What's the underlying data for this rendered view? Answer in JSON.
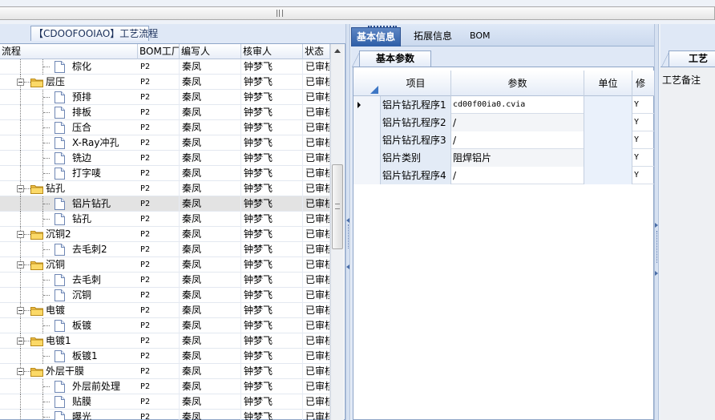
{
  "left_tab": "【CDOOFOOIAO】工艺流程",
  "tree_grid": {
    "headers": [
      "流程",
      "BOM工厂",
      "编写人",
      "核审人",
      "状态"
    ],
    "rows": [
      {
        "name": "棕化",
        "level": 2,
        "type": "doc",
        "bom": "P2",
        "writer": "秦凤",
        "reviewer": "钟梦飞",
        "status": "已审核"
      },
      {
        "name": "层压",
        "level": 1,
        "type": "folder",
        "bom": "P2",
        "writer": "秦凤",
        "reviewer": "钟梦飞",
        "status": "已审核"
      },
      {
        "name": "预排",
        "level": 2,
        "type": "doc",
        "bom": "P2",
        "writer": "秦凤",
        "reviewer": "钟梦飞",
        "status": "已审核"
      },
      {
        "name": "排板",
        "level": 2,
        "type": "doc",
        "bom": "P2",
        "writer": "秦凤",
        "reviewer": "钟梦飞",
        "status": "已审核"
      },
      {
        "name": "压合",
        "level": 2,
        "type": "doc",
        "bom": "P2",
        "writer": "秦凤",
        "reviewer": "钟梦飞",
        "status": "已审核"
      },
      {
        "name": "X-Ray冲孔",
        "level": 2,
        "type": "doc",
        "bom": "P2",
        "writer": "秦凤",
        "reviewer": "钟梦飞",
        "status": "已审核"
      },
      {
        "name": "铣边",
        "level": 2,
        "type": "doc",
        "bom": "P2",
        "writer": "秦凤",
        "reviewer": "钟梦飞",
        "status": "已审核"
      },
      {
        "name": "打字唛",
        "level": 2,
        "type": "doc",
        "bom": "P2",
        "writer": "秦凤",
        "reviewer": "钟梦飞",
        "status": "已审核"
      },
      {
        "name": "钻孔",
        "level": 1,
        "type": "folder",
        "bom": "P2",
        "writer": "秦凤",
        "reviewer": "钟梦飞",
        "status": "已审核"
      },
      {
        "name": "铝片钻孔",
        "level": 2,
        "type": "doc",
        "selected": true,
        "bom": "P2",
        "writer": "秦凤",
        "reviewer": "钟梦飞",
        "status": "已审核"
      },
      {
        "name": "钻孔",
        "level": 2,
        "type": "doc",
        "bom": "P2",
        "writer": "秦凤",
        "reviewer": "钟梦飞",
        "status": "已审核"
      },
      {
        "name": "沉铜2",
        "level": 1,
        "type": "folder",
        "bom": "P2",
        "writer": "秦凤",
        "reviewer": "钟梦飞",
        "status": "已审核"
      },
      {
        "name": "去毛刺2",
        "level": 2,
        "type": "doc",
        "bom": "P2",
        "writer": "秦凤",
        "reviewer": "钟梦飞",
        "status": "已审核"
      },
      {
        "name": "沉铜",
        "level": 1,
        "type": "folder",
        "bom": "P2",
        "writer": "秦凤",
        "reviewer": "钟梦飞",
        "status": "已审核"
      },
      {
        "name": "去毛刺",
        "level": 2,
        "type": "doc",
        "bom": "P2",
        "writer": "秦凤",
        "reviewer": "钟梦飞",
        "status": "已审核"
      },
      {
        "name": "沉铜",
        "level": 2,
        "type": "doc",
        "bom": "P2",
        "writer": "秦凤",
        "reviewer": "钟梦飞",
        "status": "已审核"
      },
      {
        "name": "电镀",
        "level": 1,
        "type": "folder",
        "bom": "P2",
        "writer": "秦凤",
        "reviewer": "钟梦飞",
        "status": "已审核"
      },
      {
        "name": "板镀",
        "level": 2,
        "type": "doc",
        "bom": "P2",
        "writer": "秦凤",
        "reviewer": "钟梦飞",
        "status": "已审核"
      },
      {
        "name": "电镀1",
        "level": 1,
        "type": "folder",
        "bom": "P2",
        "writer": "秦凤",
        "reviewer": "钟梦飞",
        "status": "已审核"
      },
      {
        "name": "板镀1",
        "level": 2,
        "type": "doc",
        "bom": "P2",
        "writer": "秦凤",
        "reviewer": "钟梦飞",
        "status": "已审核"
      },
      {
        "name": "外层干膜",
        "level": 1,
        "type": "folder",
        "bom": "P2",
        "writer": "秦凤",
        "reviewer": "钟梦飞",
        "status": "已审核"
      },
      {
        "name": "外层前处理",
        "level": 2,
        "type": "doc",
        "bom": "P2",
        "writer": "秦凤",
        "reviewer": "钟梦飞",
        "status": "已审核"
      },
      {
        "name": "贴膜",
        "level": 2,
        "type": "doc",
        "bom": "P2",
        "writer": "秦凤",
        "reviewer": "钟梦飞",
        "status": "已审核"
      },
      {
        "name": "曝光",
        "level": 2,
        "type": "doc",
        "bom": "P2",
        "writer": "秦凤",
        "reviewer": "钟梦飞",
        "status": "已审核"
      }
    ]
  },
  "mid_tabs": [
    "基本信息",
    "拓展信息",
    "BOM"
  ],
  "sub_tab": "基本参数",
  "param_grid": {
    "headers": [
      "项目",
      "参数",
      "单位",
      "修"
    ],
    "rows": [
      {
        "item": "铝片钻孔程序1",
        "param": "cd00f00ia0.cvia",
        "unit": "",
        "flag": "Y",
        "current": true
      },
      {
        "item": "铝片钻孔程序2",
        "param": "/",
        "unit": "",
        "flag": "Y"
      },
      {
        "item": "铝片钻孔程序3",
        "param": "/",
        "unit": "",
        "flag": "Y"
      },
      {
        "item": "铝片类别",
        "param": "阻焊铝片",
        "unit": "",
        "flag": "Y"
      },
      {
        "item": "铝片钻孔程序4",
        "param": "/",
        "unit": "",
        "flag": "Y"
      }
    ]
  },
  "right_tab": "工艺",
  "right_label": "工艺备注"
}
